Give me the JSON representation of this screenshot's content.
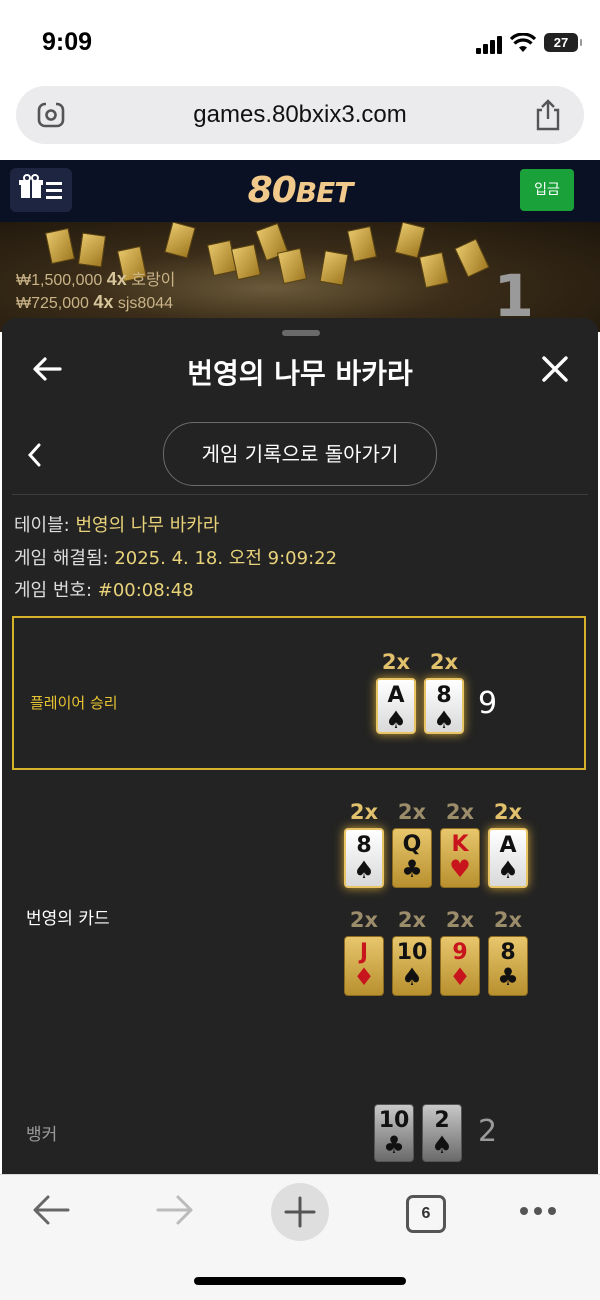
{
  "status_bar": {
    "time": "9:09",
    "battery": "27"
  },
  "browser": {
    "url": "games.80bxix3.com",
    "tab_count": "6"
  },
  "site": {
    "logo_main": "80",
    "logo_sub": "BET",
    "deposit_label": "입금"
  },
  "banner": {
    "wins": [
      {
        "amount": "₩1,500,000",
        "mult": "4x",
        "user": "호랑이"
      },
      {
        "amount": "₩725,000",
        "mult": "4x",
        "user": "sjs8044"
      }
    ],
    "rank": "1"
  },
  "modal": {
    "title": "번영의 나무 바카라",
    "back_to_history": "게임 기록으로 돌아가기",
    "info": {
      "table_label": "테이블: ",
      "table_value": "번영의 나무 바카라",
      "resolved_label": "게임 해결됨: ",
      "resolved_value": "2025. 4. 18. 오전 9:09:22",
      "number_label": "게임 번호: ",
      "number_value": "#00:08:48"
    },
    "player": {
      "label": "플레이어 승리",
      "total": "9",
      "cards": [
        {
          "mult": "2x",
          "rank": "A",
          "suit": "♠"
        },
        {
          "mult": "2x",
          "rank": "8",
          "suit": "♠"
        }
      ]
    },
    "lucky": {
      "label": "번영의 카드",
      "row1": [
        {
          "mult": "2x",
          "rank": "8",
          "suit": "♠",
          "style": "white"
        },
        {
          "mult": "2x",
          "rank": "Q",
          "suit": "♣",
          "style": "gold"
        },
        {
          "mult": "2x",
          "rank": "K",
          "suit": "♥",
          "style": "gold"
        },
        {
          "mult": "2x",
          "rank": "A",
          "suit": "♠",
          "style": "white"
        }
      ],
      "row2": [
        {
          "mult": "2x",
          "rank": "J",
          "suit": "♦",
          "style": "gold"
        },
        {
          "mult": "2x",
          "rank": "10",
          "suit": "♠",
          "style": "gold"
        },
        {
          "mult": "2x",
          "rank": "9",
          "suit": "♦",
          "style": "gold"
        },
        {
          "mult": "2x",
          "rank": "8",
          "suit": "♣",
          "style": "gold"
        }
      ]
    },
    "banker": {
      "label": "뱅커",
      "total": "2",
      "cards": [
        {
          "rank": "10",
          "suit": "♣"
        },
        {
          "rank": "2",
          "suit": "♠"
        }
      ]
    }
  }
}
